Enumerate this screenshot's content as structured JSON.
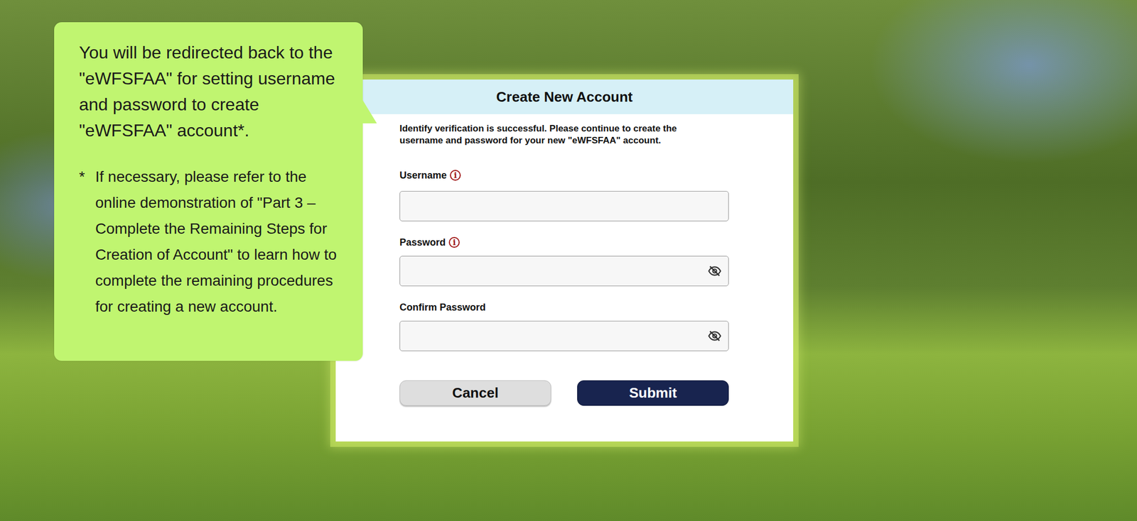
{
  "callout": {
    "message": "You will be redirected back to the \"eWFSFAA\" for setting username and password to create \"eWFSFAA\" account*.",
    "note_marker": "*",
    "note": "If necessary, please refer to the online demonstration of \"Part 3 – Complete the Remaining Steps for Creation of Account\" to learn how to complete the remaining procedures for creating a new account."
  },
  "dialog": {
    "title": "Create New Account",
    "message": "Identify verification is successful. Please continue to create the username and password for your new \"eWFSFAA\" account.",
    "fields": [
      {
        "label": "Username",
        "kind": "text",
        "info_icon": "i"
      },
      {
        "label": "Password",
        "kind": "password",
        "info_icon": "i"
      },
      {
        "label": "Confirm Password",
        "kind": "password",
        "info_icon": ""
      }
    ],
    "buttons": [
      {
        "label": "Cancel",
        "kind": "secondary"
      },
      {
        "label": "Submit",
        "kind": "primary"
      }
    ]
  }
}
